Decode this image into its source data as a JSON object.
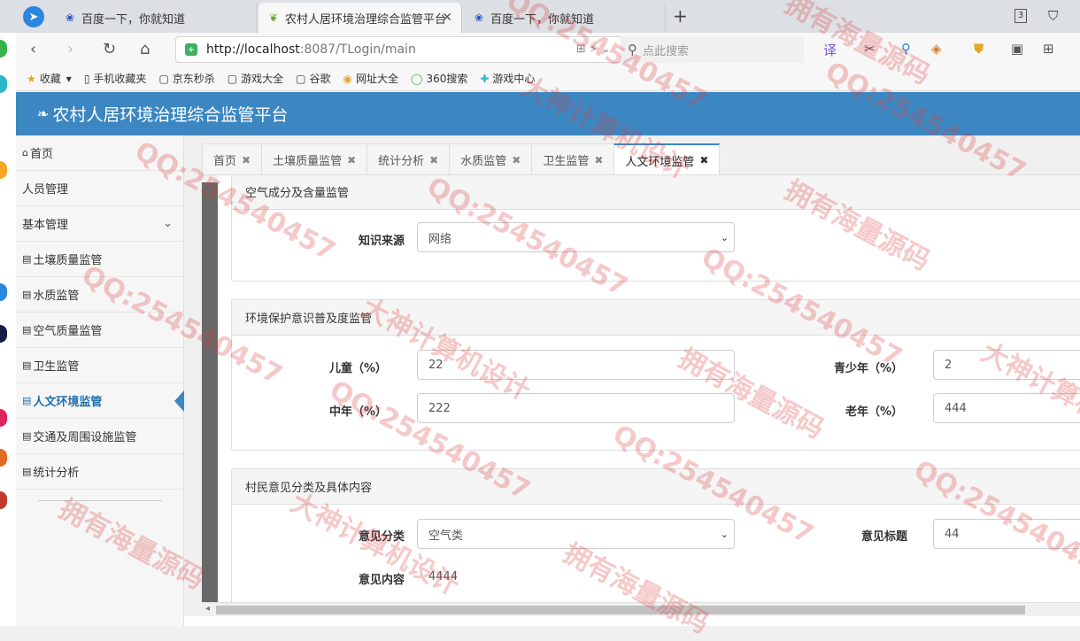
{
  "browser": {
    "tabs": [
      {
        "title": "百度一下，你就知道",
        "icon": "baidu-paw-icon",
        "active": false
      },
      {
        "title": "农村人居环境治理综合监管平台",
        "icon": "leaf-icon",
        "active": true
      },
      {
        "title": "百度一下，你就知道",
        "icon": "baidu-paw-icon",
        "active": false
      }
    ],
    "tab_count": "3",
    "url_host": "http://localhost",
    "url_rest": ":8087/TLogin/main",
    "search_placeholder": "点此搜索",
    "bookmarks": [
      {
        "label": "收藏",
        "icon": "star-icon"
      },
      {
        "label": "手机收藏夹",
        "icon": "phone-icon"
      },
      {
        "label": "京东秒杀",
        "icon": "page-icon"
      },
      {
        "label": "游戏大全",
        "icon": "page-icon"
      },
      {
        "label": "谷歌",
        "icon": "page-icon"
      },
      {
        "label": "网址大全",
        "icon": "globe-icon"
      },
      {
        "label": "360搜索",
        "icon": "search-360-icon"
      },
      {
        "label": "游戏中心",
        "icon": "gamepad-icon"
      }
    ],
    "tool_translate": "译"
  },
  "app": {
    "title": "农村人居环境治理综合监管平台"
  },
  "sidebar": {
    "items": [
      {
        "label": "首页",
        "icon": "home-icon"
      },
      {
        "label": "人员管理",
        "icon": ""
      },
      {
        "label": "基本管理",
        "icon": "",
        "expandable": true
      },
      {
        "label": "土壤质量监管",
        "icon": "list-icon"
      },
      {
        "label": "水质监管",
        "icon": "list-icon"
      },
      {
        "label": "空气质量监管",
        "icon": "list-icon"
      },
      {
        "label": "卫生监管",
        "icon": "list-icon"
      },
      {
        "label": "人文环境监管",
        "icon": "list-icon",
        "active": true
      },
      {
        "label": "交通及周围设施监管",
        "icon": "list-icon"
      },
      {
        "label": "统计分析",
        "icon": "list-icon"
      }
    ]
  },
  "content_tabs": [
    {
      "label": "首页",
      "active": false
    },
    {
      "label": "土壤质量监管",
      "active": false
    },
    {
      "label": "统计分析",
      "active": false
    },
    {
      "label": "水质监管",
      "active": false
    },
    {
      "label": "卫生监管",
      "active": false
    },
    {
      "label": "人文环境监管",
      "active": true
    }
  ],
  "panels": {
    "air": {
      "title": "空气成分及含量监管",
      "knowledge_source_label": "知识来源",
      "knowledge_source_value": "网络"
    },
    "awareness": {
      "title": "环境保护意识普及度监管",
      "child_label": "儿童（%）",
      "child_value": "22",
      "teen_label": "青少年（%）",
      "teen_value": "2",
      "middle_label": "中年（%）",
      "middle_value": "222",
      "elder_label": "老年（%）",
      "elder_value": "444"
    },
    "opinion": {
      "title": "村民意见分类及具体内容",
      "category_label": "意见分类",
      "category_value": "空气类",
      "subject_label": "意见标题",
      "subject_value": "44",
      "content_label": "意见内容",
      "content_value": "4444"
    }
  },
  "watermark": {
    "qq": "QQ:254540457",
    "a": "拥有海量源码",
    "b": "大神计算机设计"
  },
  "colors": {
    "header_blue": "#3c87c2",
    "active_link": "#1d6fb0"
  }
}
